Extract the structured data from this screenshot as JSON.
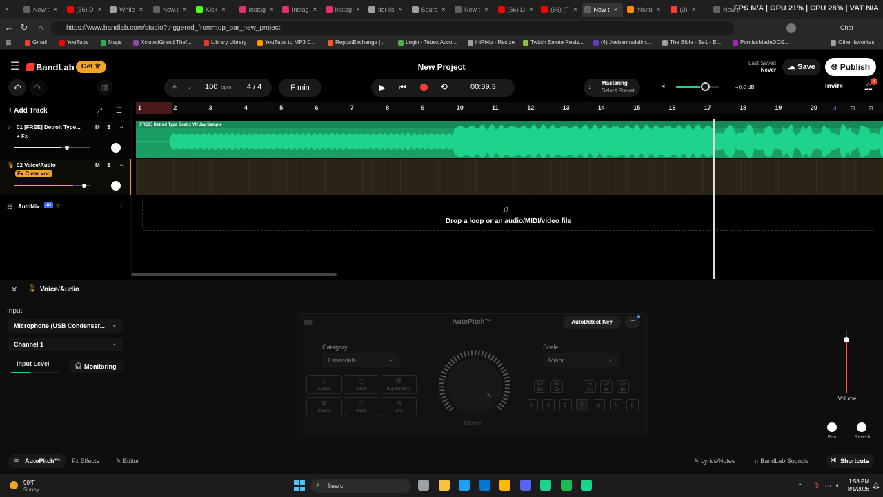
{
  "browser": {
    "tabs": [
      {
        "label": "New t",
        "color": "#5f6368"
      },
      {
        "label": "(66) D",
        "color": "#ff0000"
      },
      {
        "label": "While",
        "color": "#9aa0a6"
      },
      {
        "label": "New t",
        "color": "#5f6368"
      },
      {
        "label": "Kick",
        "color": "#53fc18"
      },
      {
        "label": "Instag",
        "color": "#e1306c"
      },
      {
        "label": "Instag",
        "color": "#e1306c"
      },
      {
        "label": "Instag",
        "color": "#e1306c"
      },
      {
        "label": "tier lis",
        "color": "#9aa0a6"
      },
      {
        "label": "Searc",
        "color": "#9aa0a6"
      },
      {
        "label": "New t",
        "color": "#5f6368"
      },
      {
        "label": "(66) Li",
        "color": "#ff0000"
      },
      {
        "label": "(66) (F",
        "color": "#ff0000"
      },
      {
        "label": "New t",
        "color": "#5f6368"
      },
      {
        "label": "Youtu",
        "color": "#ff8c00"
      },
      {
        "label": "(3)",
        "color": "#ff3b30"
      },
      {
        "label": "New t",
        "color": "#5f6368"
      }
    ],
    "hud": "FPS N/A | GPU 21% | CPU 28% | VAT N/A",
    "url": "https://www.bandlab.com/studio?triggered_from=top_bar_new_project",
    "chat_label": "Chat",
    "bookmarks": [
      {
        "label": "Gmail",
        "color": "#ea4335"
      },
      {
        "label": "YouTube",
        "color": "#ff0000"
      },
      {
        "label": "Maps",
        "color": "#34a853"
      },
      {
        "label": "XclutedGrand Thef...",
        "color": "#8e44ad"
      },
      {
        "label": "Library Library",
        "color": "#e53935"
      },
      {
        "label": "YouTube to MP3 C...",
        "color": "#ff9800"
      },
      {
        "label": "RepostExchange |...",
        "color": "#ff5722"
      },
      {
        "label": "Login - Tebex Acco...",
        "color": "#4caf50"
      },
      {
        "label": "iniPixio - Resize",
        "color": "#9aa0a6"
      },
      {
        "label": "Twitch Emote Resiz...",
        "color": "#8bc34a"
      },
      {
        "label": "(4) Joebannedslim...",
        "color": "#673ab7"
      },
      {
        "label": "The Bible - Se1 - E...",
        "color": "#9aa0a6"
      },
      {
        "label": "PontiacMadeDDG...",
        "color": "#9c27b0"
      }
    ],
    "other_bookmarks": "Other favorites"
  },
  "header": {
    "brand": "BandLab",
    "get_label": "Get",
    "project_title": "New Project",
    "last_saved_label": "Last Saved",
    "last_saved_value": "Never",
    "save_label": "Save",
    "publish_label": "Publish"
  },
  "transport": {
    "bpm": "100",
    "bpm_unit": "bpm",
    "time_sig": "4 / 4",
    "key": "F min",
    "time": "00:39.3",
    "mastering_title": "Mastering",
    "mastering_sub": "Select Preset",
    "db": "+0.0 dB",
    "invite_label": "Invite",
    "notif_count": "2",
    "master_volume_level": 0.55
  },
  "tracks_panel": {
    "add_track_label": "Add Track",
    "tracks": [
      {
        "name": "01  [FREE] Detroit Type...",
        "fx": "+ Fx",
        "m": "M",
        "s": "S",
        "volume": 0.62,
        "region_label": "[FREE] Detroit Type Beat x YN Jay Sample"
      },
      {
        "name": "02  Voice/Audio",
        "fx": "Fx Clear voc",
        "m": "M",
        "s": "S",
        "volume": 0.78
      }
    ],
    "automix_label": "AutoMix",
    "automix_ai": "AI",
    "ruler": [
      "1",
      "2",
      "3",
      "4",
      "5",
      "6",
      "7",
      "8",
      "9",
      "10",
      "11",
      "12",
      "13",
      "14",
      "15",
      "16",
      "17",
      "18",
      "19",
      "20"
    ],
    "drop_text": "Drop a loop or an audio/MIDI/video file"
  },
  "bottom_panel": {
    "title": "Voice/Audio",
    "input_label": "Input",
    "input_device": "Microphone (USB Condenser...",
    "channel": "Channel 1",
    "input_level_label": "Input Level",
    "monitoring_label": "Monitoring",
    "autopitch_title": "AutoPitch™",
    "autodetect_label": "AutoDetect Key",
    "category_label": "Category",
    "category_value": "Essentials",
    "scale_label": "Scale",
    "scale_value": "Minor",
    "effect_buttons": [
      "Classic",
      "Duet",
      "Big Harmony",
      "Natural",
      "Hard",
      "Chip"
    ],
    "knob_label": "Heaviest",
    "keys_top": [
      "C#\nDb",
      "D#\nEb",
      "F#\nGb",
      "G#\nAb",
      "A#\nBb"
    ],
    "keys_bottom": [
      "C",
      "D",
      "E",
      "F",
      "G",
      "A",
      "B"
    ],
    "volume_label": "Volume",
    "pan_label": "Pan",
    "reverb_label": "Reverb",
    "tabs": {
      "autopitch": "AutoPitch™",
      "effects": "Effects",
      "editor": "Editor"
    },
    "lyrics_label": "Lyrics/Notes",
    "sounds_label": "BandLab Sounds",
    "shortcuts_label": "Shortcuts"
  },
  "taskbar": {
    "weather_temp": "90°F",
    "weather_desc": "Sunny",
    "search_label": "Search",
    "time": "1:58 PM",
    "date": "8/1/2026"
  },
  "colors": {
    "accent": "#ff3b30",
    "waveform": "#1ed48a",
    "track_bg": "#1b9e64",
    "voice_bg": "#2a2416",
    "get_btn": "#f5a524"
  }
}
